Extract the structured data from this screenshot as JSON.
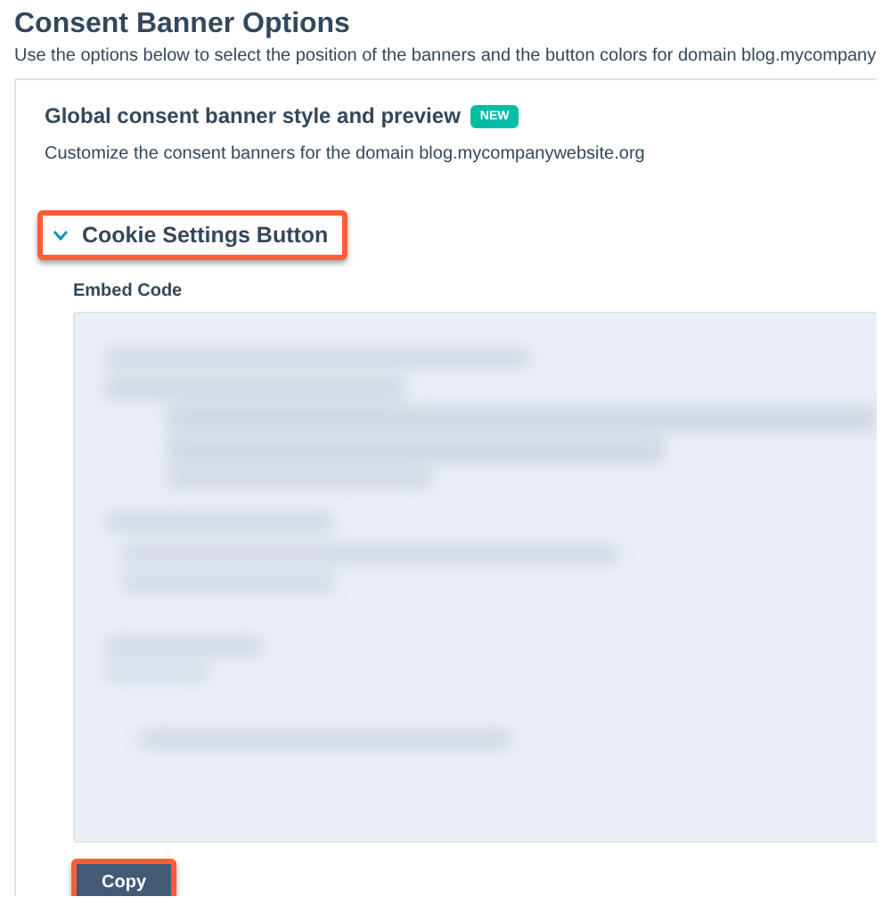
{
  "page": {
    "title": "Consent Banner Options",
    "subtitle": "Use the options below to select the position of the banners and the button colors for domain blog.mycompany"
  },
  "card": {
    "heading": "Global consent banner style and preview",
    "badge": "NEW",
    "description": "Customize the consent banners for the domain blog.mycompanywebsite.org"
  },
  "section": {
    "label": "Cookie Settings Button",
    "expanded": true,
    "highlighted": true
  },
  "embed": {
    "label": "Embed Code",
    "code": {
      "kind": "blurred"
    }
  },
  "copy_button": {
    "label": "Copy",
    "highlighted": true
  }
}
